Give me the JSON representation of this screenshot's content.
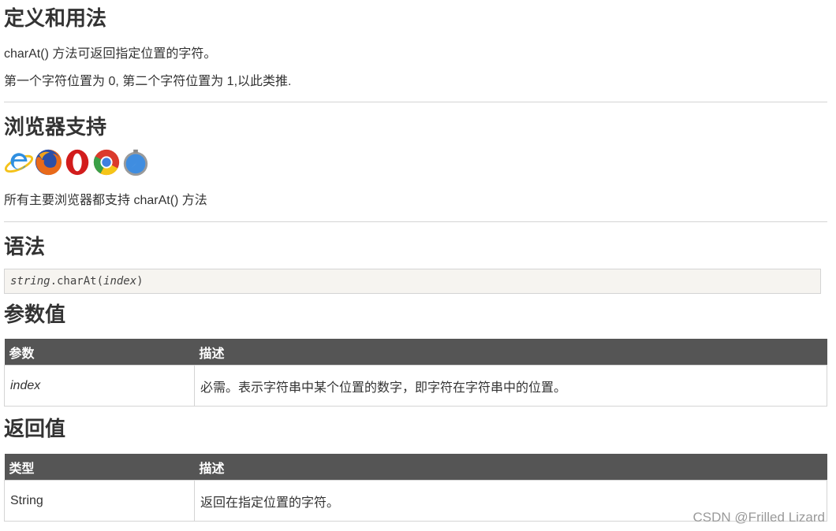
{
  "sections": {
    "definition": {
      "title": "定义和用法",
      "line1": "charAt() 方法可返回指定位置的字符。",
      "line2": "第一个字符位置为 0, 第二个字符位置为 1,以此类推."
    },
    "browser_support": {
      "title": "浏览器支持",
      "icons": [
        "ie-icon",
        "firefox-icon",
        "opera-icon",
        "chrome-icon",
        "safari-icon"
      ],
      "text": "所有主要浏览器都支持 charAt() 方法"
    },
    "syntax": {
      "title": "语法",
      "code_object": "string",
      "code_method": ".charAt(",
      "code_param": "index",
      "code_close": ")"
    },
    "parameters": {
      "title": "参数值",
      "headers": [
        "参数",
        "描述"
      ],
      "rows": [
        [
          "index",
          "必需。表示字符串中某个位置的数字，即字符在字符串中的位置。"
        ]
      ]
    },
    "return_value": {
      "title": "返回值",
      "headers": [
        "类型",
        "描述"
      ],
      "rows": [
        [
          "String",
          "返回在指定位置的字符。"
        ]
      ]
    }
  },
  "watermark": "CSDN @Frilled Lizard",
  "colors": {
    "table_header_bg": "#555555",
    "code_bg": "#f6f4f0",
    "border": "#d4d4d4"
  }
}
